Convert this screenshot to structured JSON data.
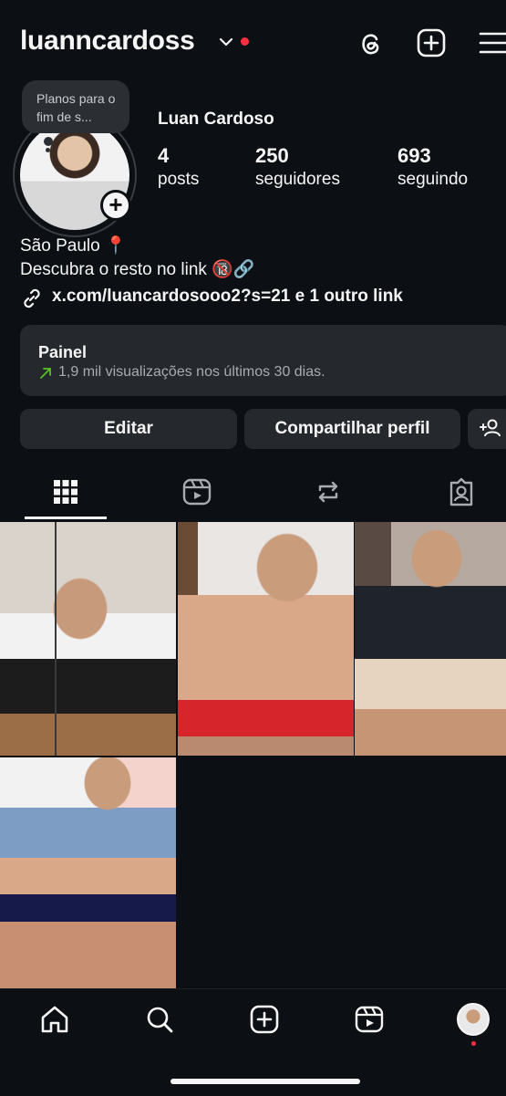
{
  "header": {
    "username": "luanncardoss",
    "accent": "#ff3040"
  },
  "profile": {
    "note": "Planos para o fim de s...",
    "full_name": "Luan Cardoso",
    "stats": [
      {
        "value": "4",
        "label": "posts"
      },
      {
        "value": "250",
        "label": "seguidores"
      },
      {
        "value": "693",
        "label": "seguindo"
      }
    ],
    "bio_line1": "São Paulo 📍",
    "bio_line2": "Descubra o resto no link 🔞🔗",
    "link": "x.com/luancardosooo2?s=21 e 1 outro link"
  },
  "dashboard": {
    "title": "Painel",
    "subtitle": "1,9 mil visualizações nos últimos 30 dias."
  },
  "buttons": {
    "edit": "Editar",
    "share": "Compartilhar perfil"
  },
  "icons": {
    "header": [
      "threads-icon",
      "add-post-icon",
      "menu-icon"
    ],
    "tabs": [
      "grid-icon",
      "reels-icon",
      "reposts-icon",
      "tagged-icon"
    ],
    "nav": [
      "home-icon",
      "search-icon",
      "create-icon",
      "reels-icon",
      "profile-avatar"
    ]
  }
}
